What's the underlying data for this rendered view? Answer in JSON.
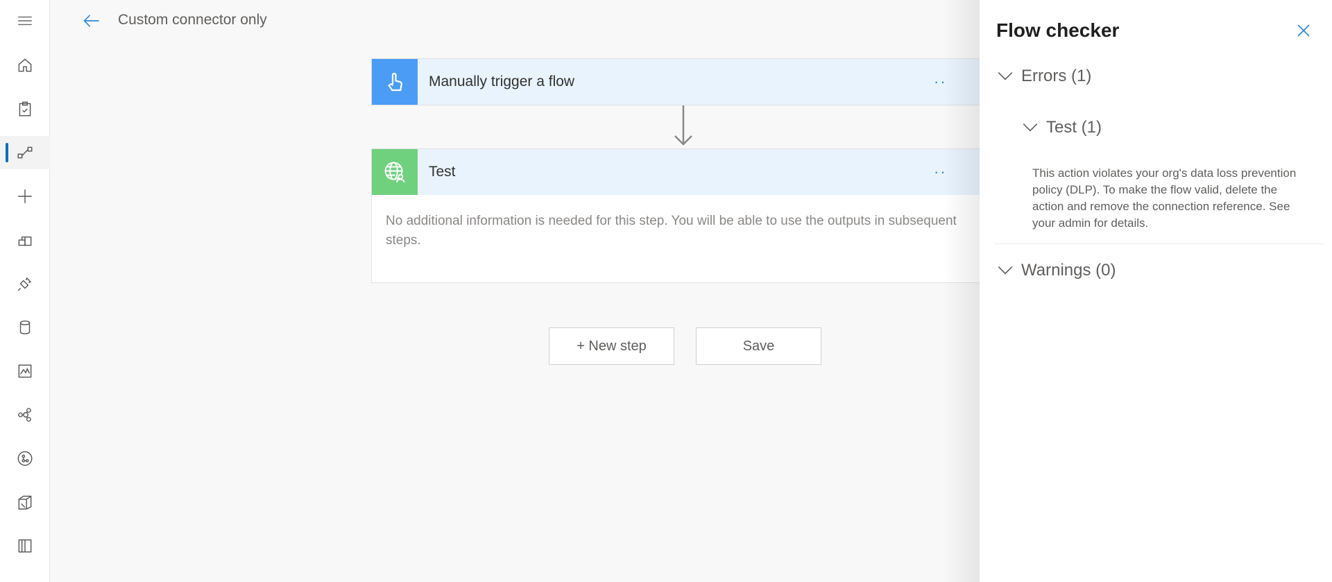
{
  "topbar": {
    "title": "Custom connector only"
  },
  "rail": {
    "items": [
      {
        "name": "menu",
        "icon": "hamburger-icon"
      },
      {
        "name": "home",
        "icon": "home-icon"
      },
      {
        "name": "approvals",
        "icon": "clipboard-check-icon"
      },
      {
        "name": "my-flows",
        "icon": "flow-icon",
        "active": true
      },
      {
        "name": "create",
        "icon": "plus-icon"
      },
      {
        "name": "templates",
        "icon": "templates-icon"
      },
      {
        "name": "connectors",
        "icon": "plug-icon"
      },
      {
        "name": "data",
        "icon": "database-icon"
      },
      {
        "name": "monitor",
        "icon": "chart-icon"
      },
      {
        "name": "ai-builder",
        "icon": "network-icon"
      },
      {
        "name": "process-advisor",
        "icon": "process-icon"
      },
      {
        "name": "solutions",
        "icon": "solutions-icon"
      },
      {
        "name": "learn",
        "icon": "book-icon"
      }
    ]
  },
  "steps": [
    {
      "title": "Manually trigger a flow",
      "icon": "touch-hand-icon",
      "color": "#4b9cf5"
    },
    {
      "title": "Test",
      "icon": "globe-user-icon",
      "color": "#6fd07e",
      "body": "No additional information is needed for this step. You will be able to use the outputs in subsequent steps."
    }
  ],
  "buttons": {
    "new_step": "+ New step",
    "save": "Save"
  },
  "checker": {
    "title": "Flow checker",
    "errors_label": "Errors (1)",
    "test_label": "Test (1)",
    "error_message": "This action violates your org's data loss prevention policy (DLP). To make the flow valid, delete the action and remove the connection reference. See your admin for details.",
    "warnings_label": "Warnings (0)"
  },
  "colors": {
    "accent": "#0f6cbd",
    "trigger": "#4b9cf5",
    "action": "#6fd07e",
    "card_header": "#e8f3fd"
  }
}
